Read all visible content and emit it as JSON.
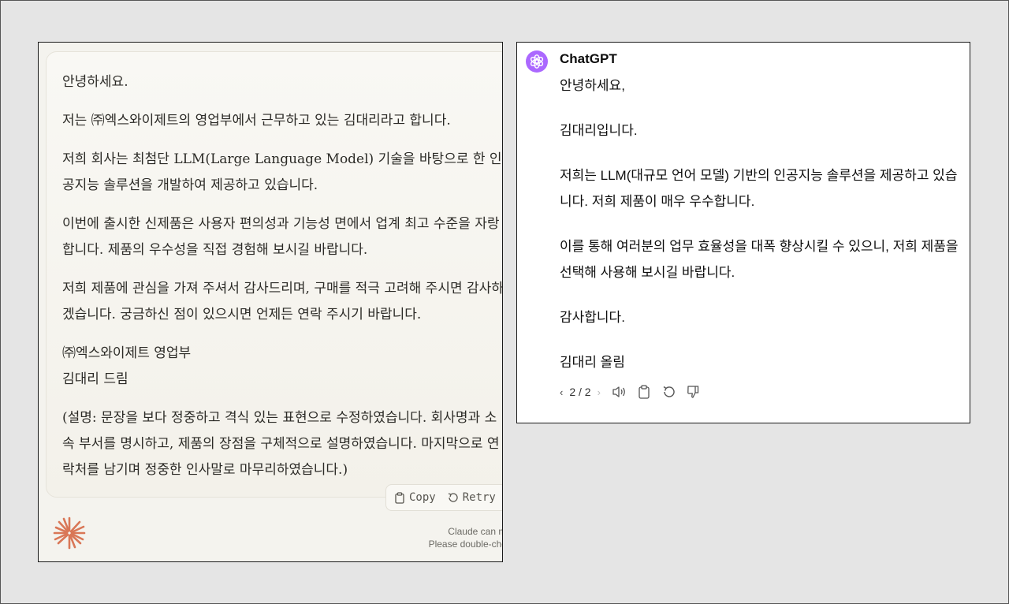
{
  "claude": {
    "paragraphs": [
      "안녕하세요.",
      "저는 ㈜엑스와이제트의 영업부에서 근무하고 있는 김대리라고 합니다.",
      "저희 회사는 최첨단 LLM(Large Language Model) 기술을 바탕으로 한 인공지능 솔루션을 개발하여 제공하고 있습니다.",
      "이번에 출시한 신제품은 사용자 편의성과 기능성 면에서 업계 최고 수준을 자랑합니다. 제품의 우수성을 직접 경험해 보시길 바랍니다.",
      "저희 제품에 관심을 가져 주셔서 감사드리며, 구매를 적극 고려해 주시면 감사하겠습니다. 궁금하신 점이 있으시면 언제든 연락 주시기 바랍니다."
    ],
    "signature_company": "㈜엑스와이제트 영업부",
    "signature_name": "김대리 드림",
    "note": "(설명: 문장을 보다 정중하고 격식 있는 표현으로 수정하였습니다. 회사명과 소속 부서를 명시하고, 제품의 장점을 구체적으로 설명하였습니다. 마지막으로 연락처를 남기며 정중한 인사말로 마무리하였습니다.)",
    "copy_label": "Copy",
    "retry_label": "Retry",
    "disclaimer_line1": "Claude can make r",
    "disclaimer_line2": "Please double-check re",
    "logo_color": "#d97757"
  },
  "chatgpt": {
    "name": "ChatGPT",
    "avatar_color": "#ab68ff",
    "paragraphs": [
      "안녕하세요,",
      "김대리입니다.",
      "저희는 LLM(대규모 언어 모델) 기반의 인공지능 솔루션을 제공하고 있습니다. 저희 제품이 매우 우수합니다.",
      "이를 통해 여러분의 업무 효율성을 대폭 향상시킬 수 있으니, 저희 제품을 선택해 사용해 보시길 바랍니다.",
      "감사합니다.",
      "김대리 올림"
    ],
    "pager": "2 / 2",
    "toolbar_icons": [
      "read-aloud-icon",
      "copy-icon",
      "regenerate-icon",
      "thumbs-down-icon"
    ]
  }
}
